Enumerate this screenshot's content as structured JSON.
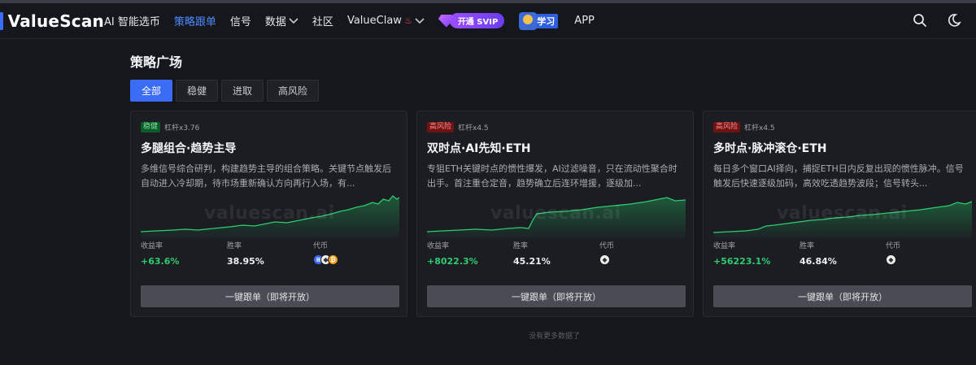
{
  "nav": {
    "logo": "ValueScan",
    "items": [
      {
        "label": "AI 智能选币",
        "active": false
      },
      {
        "label": "策略跟单",
        "active": true
      },
      {
        "label": "信号",
        "active": false
      },
      {
        "label": "数据",
        "active": false
      },
      {
        "label": "社区",
        "active": false
      },
      {
        "label": "ValueClaw",
        "active": false
      }
    ],
    "svip_label": "开通 SVIP",
    "learn_label": "学习",
    "app_label": "APP",
    "icons": [
      "search-icon",
      "moon-icon"
    ]
  },
  "main": {
    "title": "策略广场",
    "tabs": [
      "全部",
      "稳健",
      "进取",
      "高风险"
    ],
    "active_tab": 0,
    "watermark": "valuescan.ai",
    "cards": [
      {
        "risk": "稳健",
        "risk_color": "#0f5a2a",
        "leverage": "杠杆x3.76",
        "title": "多腿组合·趋势主导",
        "desc": "多维信号综合研判，构建趋势主导的组合策略。关键节点触发后自动进入冷却期，待市场重新确认方向再行入场，有...",
        "return_label": "收益率",
        "return_value": "+63.6%",
        "winrate_label": "胜率",
        "winrate_value": "38.95%",
        "coin_label": "代币",
        "coins": [
          "mix",
          "eth",
          "btc"
        ],
        "button": "一键跟单（即将开放）"
      },
      {
        "risk": "高风险",
        "risk_color": "#6e1313",
        "leverage": "杠杆x4.5",
        "title": "双时点·AI先知·ETH",
        "desc": "专狙ETH关键时点的惯性爆发，AI过滤噪音，只在流动性聚合时出手。首注重仓定音，趋势确立后连环增援，逐级加...",
        "return_label": "收益率",
        "return_value": "+8022.3%",
        "winrate_label": "胜率",
        "winrate_value": "45.21%",
        "coin_label": "代币",
        "coins": [
          "eth"
        ],
        "button": "一键跟单（即将开放）"
      },
      {
        "risk": "高风险",
        "risk_color": "#6e1313",
        "leverage": "杠杆x4.5",
        "title": "多时点·脉冲滚仓·ETH",
        "desc": "每日多个窗口AI择向，捕捉ETH日内反复出现的惯性脉冲。信号触发后快速逐级加码，高效吃透趋势波段；信号转头...",
        "return_label": "收益率",
        "return_value": "+56223.1%",
        "winrate_label": "胜率",
        "winrate_value": "46.84%",
        "coin_label": "代币",
        "coins": [
          "eth"
        ],
        "button": "一键跟单（即将开放）"
      }
    ],
    "no_more": "没有更多数据了"
  }
}
